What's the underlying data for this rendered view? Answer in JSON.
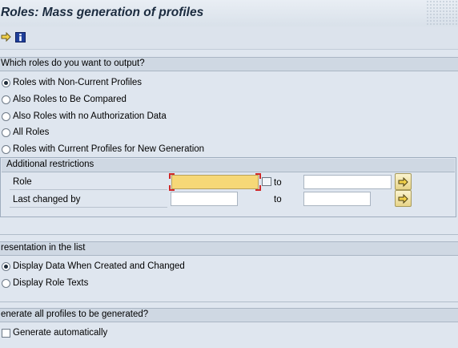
{
  "title": "Roles: Mass generation of profiles",
  "toolbar": {
    "execute_icon": "execute-arrow-icon",
    "info_icon": "information-icon"
  },
  "sections": {
    "output": {
      "header": "Which roles do you want to output?",
      "options": [
        {
          "label": "Roles with Non-Current Profiles",
          "selected": true
        },
        {
          "label": "Also Roles to Be Compared",
          "selected": false
        },
        {
          "label": "Also Roles with no Authorization Data",
          "selected": false
        },
        {
          "label": "All Roles",
          "selected": false
        },
        {
          "label": "Roles with Current Profiles for New Generation",
          "selected": false
        }
      ]
    },
    "restrictions": {
      "header": "Additional restrictions",
      "to_label": "to",
      "fields": [
        {
          "label": "Role",
          "from_value": "",
          "to_value": ""
        },
        {
          "label": "Last changed by",
          "from_value": "",
          "to_value": ""
        }
      ]
    },
    "presentation": {
      "header": "resentation in the list",
      "options": [
        {
          "label": "Display Data When Created and Changed",
          "selected": true
        },
        {
          "label": "Display Role Texts",
          "selected": false
        }
      ]
    },
    "generate": {
      "header": "enerate all profiles to be generated?",
      "checkbox_label": "Generate automatically",
      "checked": false
    }
  },
  "colors": {
    "background": "#dfe6ef",
    "required_field": "#f6d877",
    "button": "#e7d488",
    "title_text": "#1b2b3f"
  }
}
